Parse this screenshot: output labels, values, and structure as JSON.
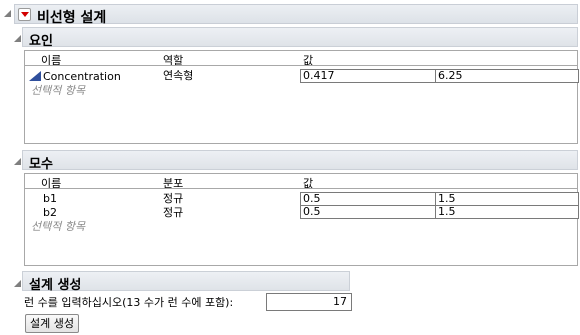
{
  "outline": {
    "title": "비선형 설계"
  },
  "factors": {
    "title": "요인",
    "headers": {
      "name": "이름",
      "role": "역할",
      "value": "값"
    },
    "rows": [
      {
        "name": "Concentration",
        "role": "연속형",
        "low": "0.417",
        "high": "6.25",
        "icon": "continuous-ramp-icon"
      }
    ],
    "optional_label": "선택적 항목"
  },
  "parameters": {
    "title": "모수",
    "headers": {
      "name": "이름",
      "distribution": "분포",
      "value": "값"
    },
    "rows": [
      {
        "name": "b1",
        "distribution": "정규",
        "v1": "0.5",
        "v2": "1.5"
      },
      {
        "name": "b2",
        "distribution": "정규",
        "v1": "0.5",
        "v2": "1.5"
      }
    ],
    "optional_label": "선택적 항목"
  },
  "design_generation": {
    "title": "설계 생성",
    "runs_label": "런 수를 입력하십시오(13 수가 런 수에 포함):",
    "runs_value": "17",
    "button_label": "설계 생성"
  },
  "colors": {
    "ramp_icon": "#2f4f9c",
    "menu_triangle": "#d20000"
  }
}
